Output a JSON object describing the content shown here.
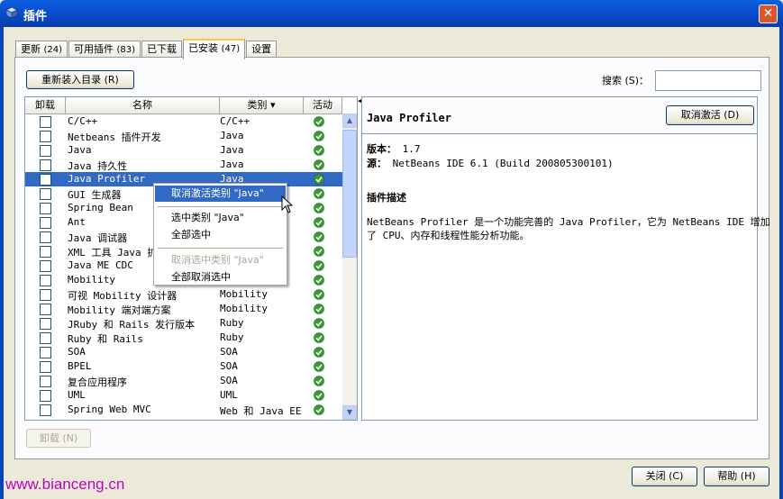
{
  "window": {
    "title": "插件",
    "close_glyph": "✕"
  },
  "tabs": [
    {
      "label": "更新",
      "count": "(24)"
    },
    {
      "label": "可用插件",
      "count": "(83)"
    },
    {
      "label": "已下载",
      "count": ""
    },
    {
      "label": "已安装",
      "count": "(47)"
    },
    {
      "label": "设置",
      "count": ""
    }
  ],
  "toolbar": {
    "reload_label": "重新装入目录 (R)",
    "search_label": "搜索 (S)：",
    "search_value": ""
  },
  "table": {
    "headers": {
      "uninstall": "卸载",
      "name": "名称",
      "category": "类别 ▾",
      "active": "活动"
    },
    "rows": [
      {
        "name": "C/C++",
        "category": "C/C++"
      },
      {
        "name": "Netbeans 插件开发",
        "category": "Java"
      },
      {
        "name": "Java",
        "category": "Java"
      },
      {
        "name": "Java 持久性",
        "category": "Java"
      },
      {
        "name": "Java Profiler",
        "category": "Java"
      },
      {
        "name": "GUI 生成器",
        "category": "Java"
      },
      {
        "name": "Spring Bean",
        "category": "Java"
      },
      {
        "name": "Ant",
        "category": "Java"
      },
      {
        "name": "Java 调试器",
        "category": "Java"
      },
      {
        "name": "XML 工具 Java 扩展",
        "category": "Java"
      },
      {
        "name": "Java ME CDC",
        "category": "Mobility"
      },
      {
        "name": "Mobility",
        "category": "Mobility"
      },
      {
        "name": "可视 Mobility 设计器",
        "category": "Mobility"
      },
      {
        "name": "Mobility 端对端方案",
        "category": "Mobility"
      },
      {
        "name": "JRuby 和 Rails 发行版本",
        "category": "Ruby"
      },
      {
        "name": "Ruby 和 Rails",
        "category": "Ruby"
      },
      {
        "name": "SOA",
        "category": "SOA"
      },
      {
        "name": "BPEL",
        "category": "SOA"
      },
      {
        "name": "复合应用程序",
        "category": "SOA"
      },
      {
        "name": "UML",
        "category": "UML"
      },
      {
        "name": "Spring Web MVC",
        "category": "Web 和 Java EE"
      }
    ],
    "selected_index": 4
  },
  "context_menu": {
    "items": [
      {
        "label": "取消激活类别 \"Java\"",
        "state": "highlighted"
      },
      {
        "label": "选中类别 \"Java\"",
        "state": "normal"
      },
      {
        "label": "全部选中",
        "state": "normal"
      },
      {
        "label": "取消选中类别 \"Java\"",
        "state": "disabled"
      },
      {
        "label": "全部取消选中",
        "state": "normal"
      }
    ]
  },
  "detail": {
    "title": "Java Profiler",
    "deactivate_label": "取消激活 (D)",
    "version_label": "版本：",
    "version_value": "1.7",
    "source_label": "源：",
    "source_value": "NetBeans IDE 6.1 (Build 200805300101)",
    "desc_heading": "插件描述",
    "desc_line1": "NetBeans Profiler 是一个功能完善的 Java Profiler，它为 NetBeans IDE 增加",
    "desc_line2": "了 CPU、内存和线程性能分析功能。"
  },
  "footer": {
    "uninstall_label": "卸载 (N)",
    "close_label": "关闭 (C)",
    "help_label": "帮助 (H)"
  },
  "watermark": "www.bianceng.cn",
  "colors": {
    "title_bar": "#0a4fd0",
    "selection": "#316ac5",
    "active_check": "#3a9b2e",
    "watermark": "#c000c0"
  }
}
